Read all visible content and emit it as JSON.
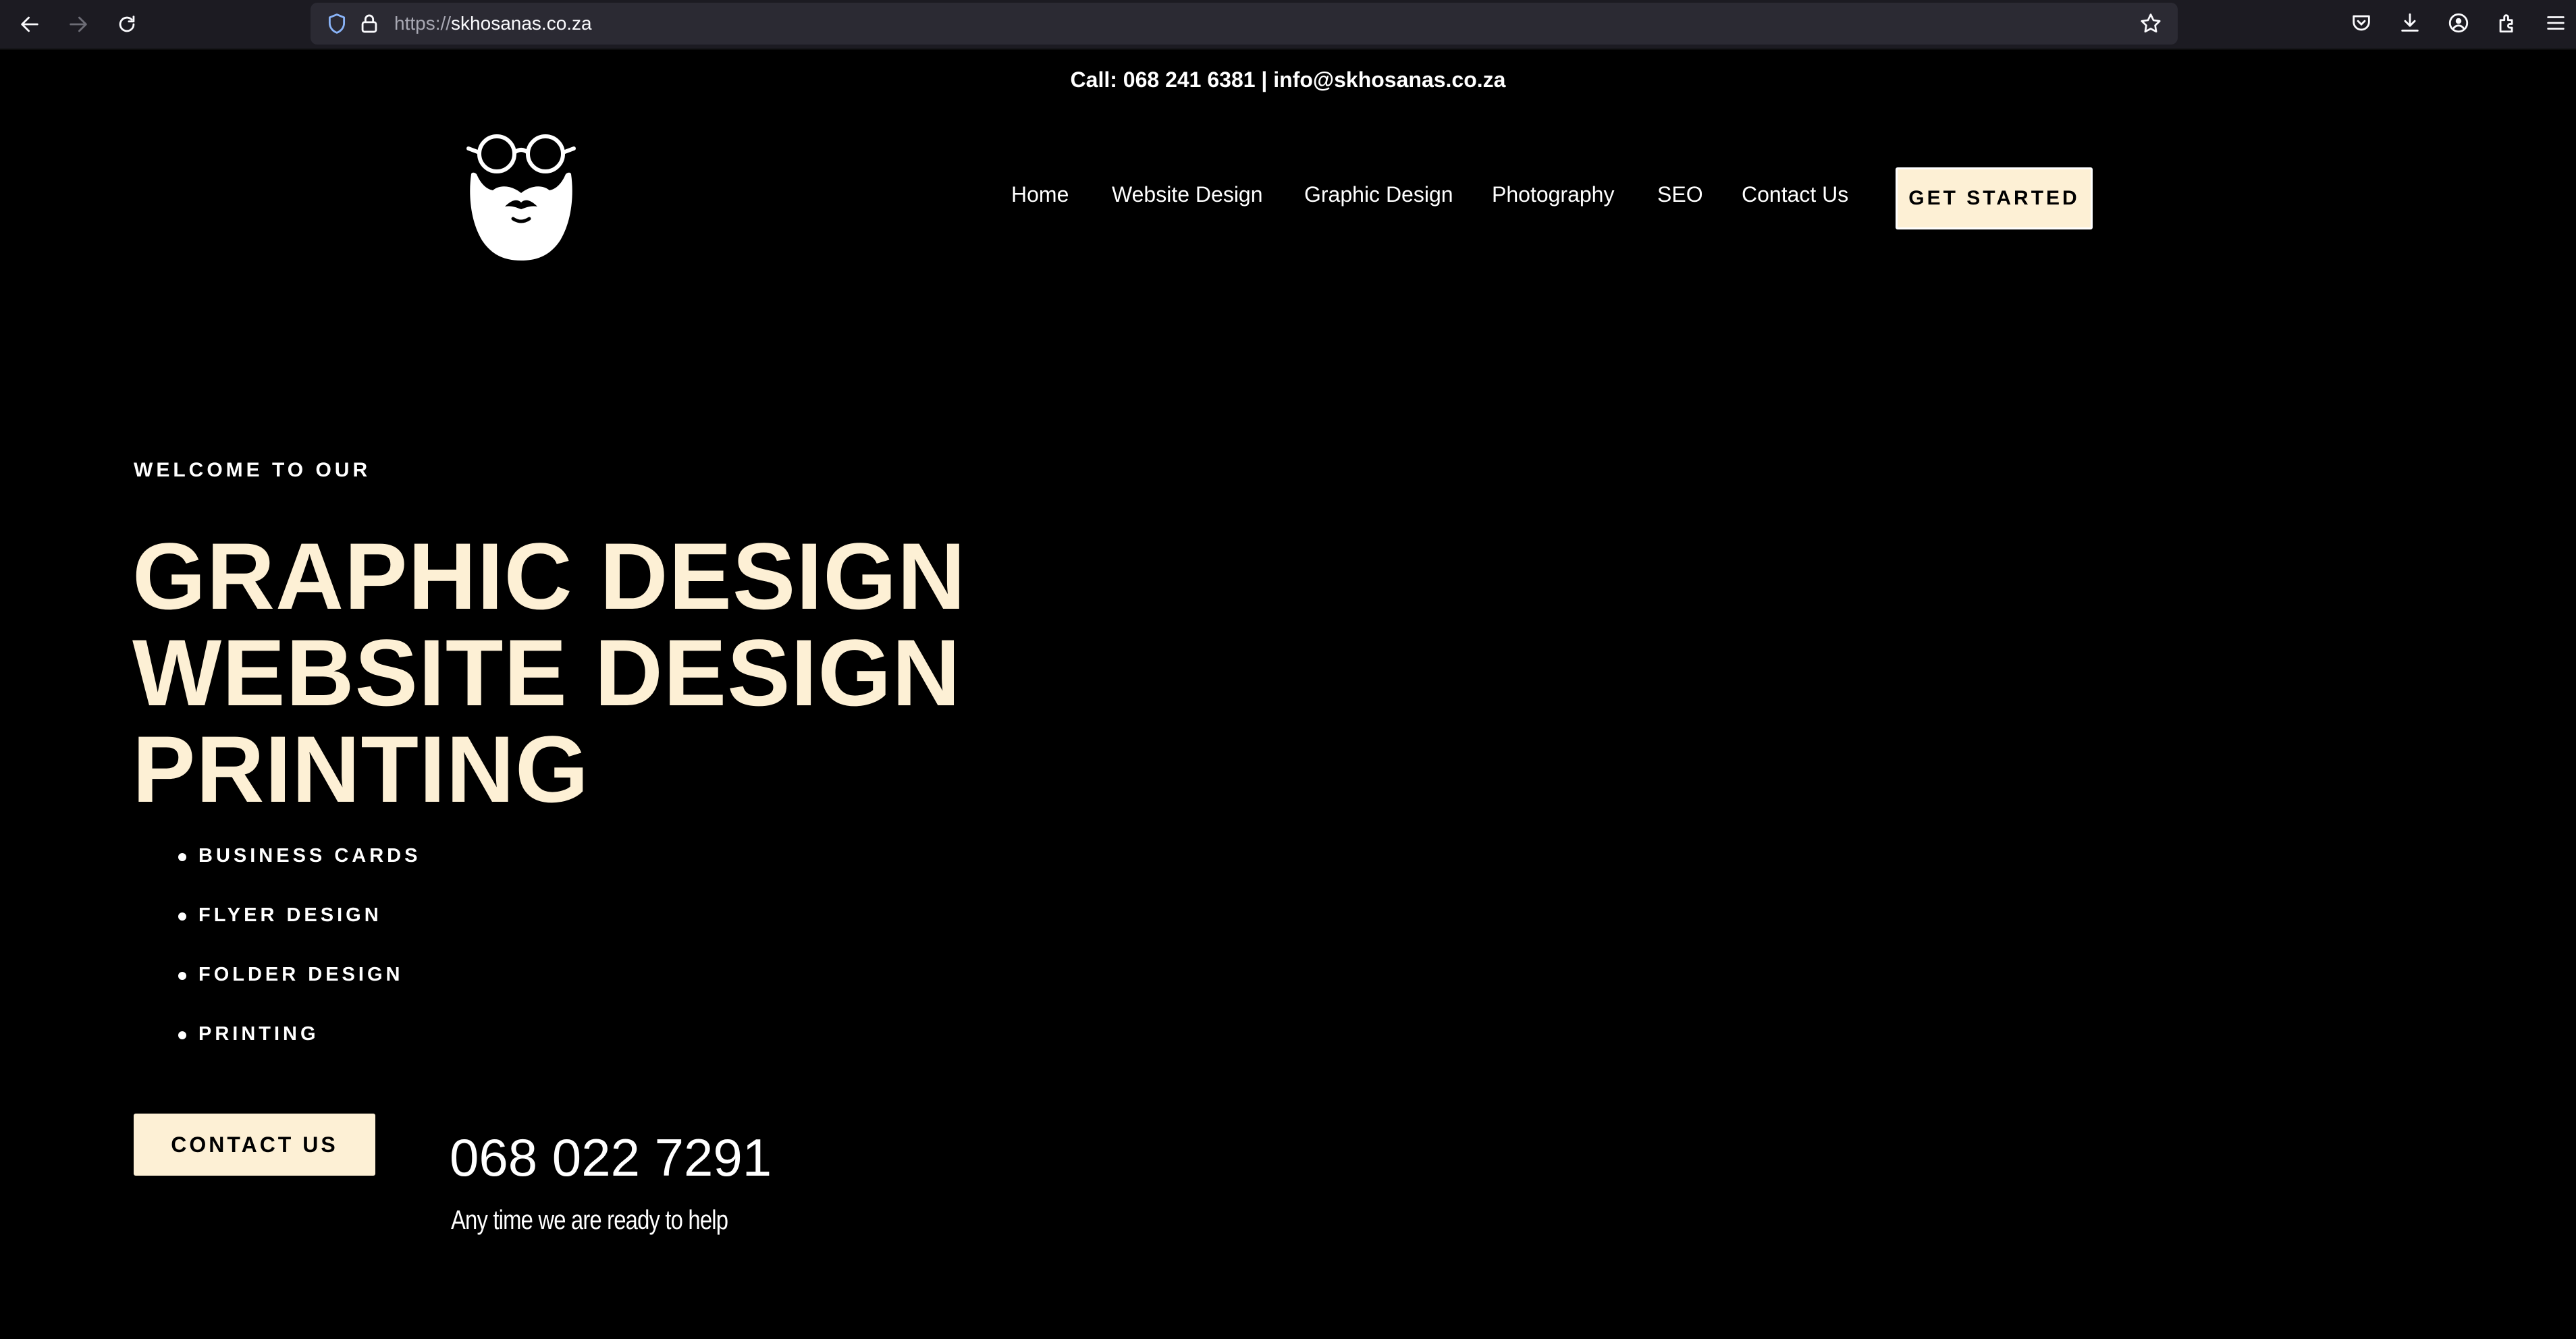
{
  "browser": {
    "url_scheme": "https://",
    "url_host": "skhosanas.co.za",
    "icons": [
      "back-arrow-icon",
      "forward-arrow-icon",
      "reload-icon",
      "shield-icon",
      "lock-icon",
      "star-icon",
      "pocket-icon",
      "download-icon",
      "account-icon",
      "extensions-icon",
      "menu-icon"
    ]
  },
  "header": {
    "contact_line": "Call: 068 241 6381 | info@skhosanas.co.za",
    "logo": "bearded-man-glasses-logo"
  },
  "nav": {
    "items": [
      "Home",
      "Website Design",
      "Graphic Design",
      "Photography",
      "SEO",
      "Contact Us"
    ],
    "cta_label": "GET STARTED"
  },
  "hero": {
    "eyebrow": "WELCOME TO OUR",
    "headline": [
      "GRAPHIC DESIGN",
      "WEBSITE DESIGN",
      "PRINTING"
    ],
    "services": [
      "BUSINESS CARDS",
      "FLYER DESIGN",
      "FOLDER DESIGN",
      "PRINTING"
    ],
    "contact_button": "CONTACT US",
    "phone": "068 022 7291",
    "phone_caption": "Any time we are ready to help"
  },
  "colors": {
    "background": "#000000",
    "accent_cream": "#fdf0d5",
    "chrome_bar": "#1c1b22",
    "url_field": "#2b2a33"
  }
}
